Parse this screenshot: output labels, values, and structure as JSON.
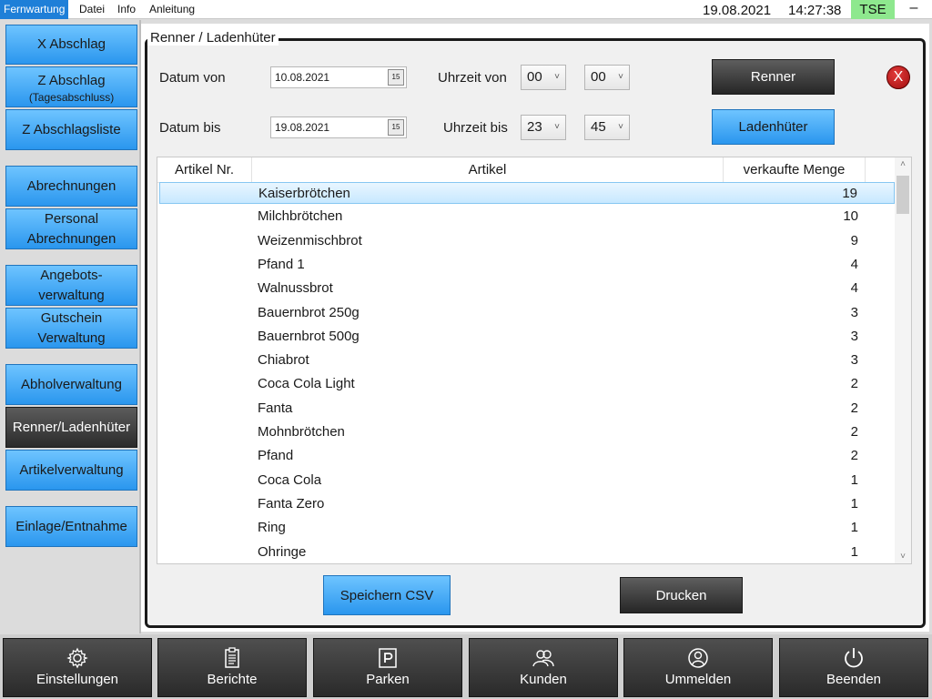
{
  "menubar": {
    "items": [
      "Fernwartung",
      "Datei",
      "Info",
      "Anleitung"
    ],
    "date": "19.08.2021",
    "time": "14:27:38",
    "tse": "TSE",
    "minimize": "–"
  },
  "sidebar": {
    "x_abschlag": "X Abschlag",
    "z_abschlag": "Z Abschlag",
    "z_abschlag_sub": "(Tagesabschluss)",
    "z_abschlagsliste": "Z Abschlagsliste",
    "abrechnungen": "Abrechnungen",
    "personal_1": "Personal",
    "personal_2": "Abrechnungen",
    "angebots_1": "Angebots-",
    "angebots_2": "verwaltung",
    "gutschein_1": "Gutschein",
    "gutschein_2": "Verwaltung",
    "abholverwaltung": "Abholverwaltung",
    "renner": "Renner/Ladenhüter",
    "artikelverwaltung": "Artikelverwaltung",
    "einlage": "Einlage/Entnahme"
  },
  "panel": {
    "title": "Renner / Ladenhüter",
    "datum_von_label": "Datum von",
    "datum_von": "10.08.2021",
    "datum_bis_label": "Datum bis",
    "datum_bis": "19.08.2021",
    "calendar_glyph": "15",
    "uhrzeit_von_label": "Uhrzeit von",
    "uhrzeit_von_h": "00",
    "uhrzeit_von_m": "00",
    "uhrzeit_bis_label": "Uhrzeit bis",
    "uhrzeit_bis_h": "23",
    "uhrzeit_bis_m": "45",
    "renner_button": "Renner",
    "ladenhueter_button": "Ladenhüter",
    "close_glyph": "X",
    "save_csv_button": "Speichern CSV",
    "print_button": "Drucken"
  },
  "table": {
    "columns": [
      "Artikel Nr.",
      "Artikel",
      "verkaufte Menge"
    ],
    "rows": [
      {
        "artikel": "Kaiserbrötchen",
        "menge": "19"
      },
      {
        "artikel": "Milchbrötchen",
        "menge": "10"
      },
      {
        "artikel": "Weizenmischbrot",
        "menge": "9"
      },
      {
        "artikel": "Pfand 1",
        "menge": "4"
      },
      {
        "artikel": "Walnussbrot",
        "menge": "4"
      },
      {
        "artikel": "Bauernbrot 250g",
        "menge": "3"
      },
      {
        "artikel": "Bauernbrot 500g",
        "menge": "3"
      },
      {
        "artikel": "Chiabrot",
        "menge": "3"
      },
      {
        "artikel": "Coca Cola Light",
        "menge": "2"
      },
      {
        "artikel": "Fanta",
        "menge": "2"
      },
      {
        "artikel": "Mohnbrötchen",
        "menge": "2"
      },
      {
        "artikel": "Pfand",
        "menge": "2"
      },
      {
        "artikel": "Coca Cola",
        "menge": "1"
      },
      {
        "artikel": "Fanta Zero",
        "menge": "1"
      },
      {
        "artikel": "Ring",
        "menge": "1"
      },
      {
        "artikel": "Ohringe",
        "menge": "1"
      }
    ]
  },
  "bottombar": {
    "einstellungen": "Einstellungen",
    "berichte": "Berichte",
    "parken": "Parken",
    "kunden": "Kunden",
    "ummelden": "Ummelden",
    "beenden": "Beenden"
  },
  "colors": {
    "accent_blue": "#2a96ee",
    "dark_button": "#2b2b2b",
    "tse_green": "#8ee88e",
    "close_red": "#c01616"
  },
  "icons": {
    "einstellungen": "gear-icon",
    "berichte": "clipboard-icon",
    "parken": "parking-icon",
    "kunden": "users-icon",
    "ummelden": "user-switch-icon",
    "beenden": "power-icon"
  }
}
